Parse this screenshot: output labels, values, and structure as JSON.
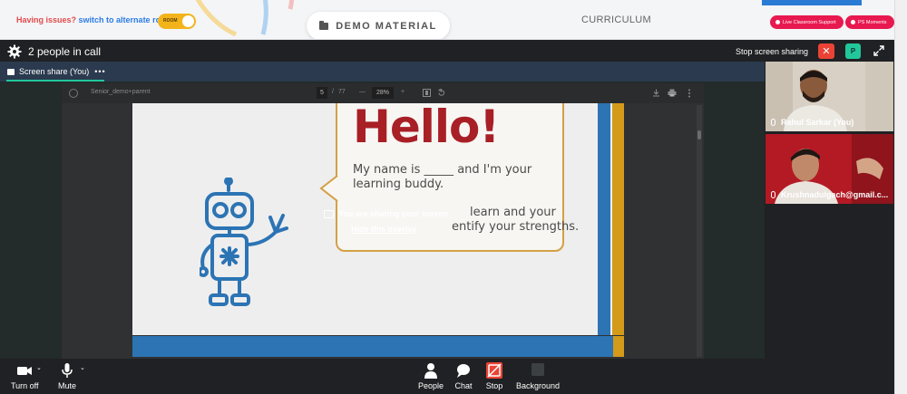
{
  "header": {
    "issue_text": "Having issues?",
    "alternate_link": "switch to alternate room",
    "toggle_label": "ROOM",
    "demo_button": "DEMO MATERIAL",
    "curriculum": "CURRICULUM",
    "support_button": "Live Classroom Support",
    "moments_button": "PS Moments",
    "accent_color": "#e8194f"
  },
  "call": {
    "people_count": "2 people in call",
    "stop_sharing": "Stop screen sharing",
    "close_symbol": "✕",
    "participant_initial": "P"
  },
  "share": {
    "tab_label": "Screen share (You)",
    "tab_more": "•••",
    "overlay_title": "You are sharing your screen",
    "overlay_hide": "Hide this overlay"
  },
  "pdf": {
    "file_name": "Senior_demo+parent",
    "page_current": "5",
    "page_sep": "/",
    "page_total": "77",
    "zoom_minus": "—",
    "zoom": "28%",
    "zoom_plus": "+"
  },
  "slide": {
    "heading": "Hello!",
    "line1": "My name is _____ and I'm your learning buddy.",
    "line2a": "learn and your",
    "line2b": "entify your strengths."
  },
  "participants": [
    {
      "name": "Rahul Sarkar (You)"
    },
    {
      "name": "Krushnadulgach@gmail.c..."
    }
  ],
  "controls": {
    "camera": "Turn off",
    "mic": "Mute",
    "people": "People",
    "chat": "Chat",
    "stop": "Stop",
    "background": "Background"
  }
}
